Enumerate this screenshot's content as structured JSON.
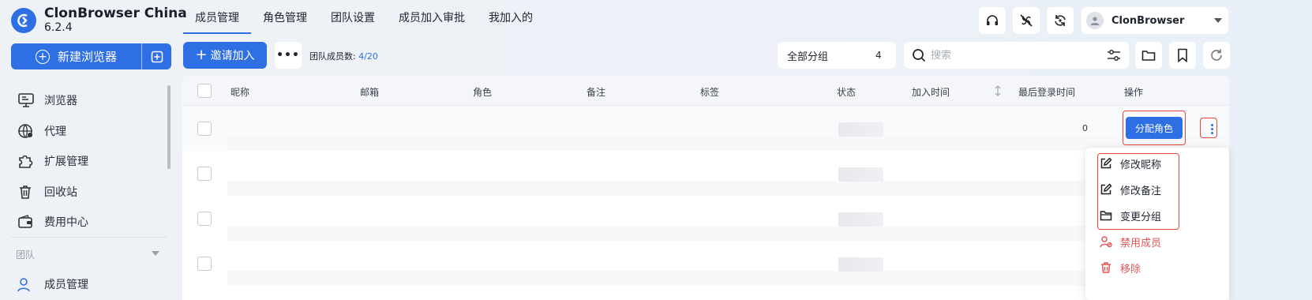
{
  "app": {
    "name": "ClonBrowser China",
    "version": "6.2.4"
  },
  "sidebar": {
    "new_browser_label": "新建浏览器",
    "items": [
      {
        "label": "浏览器",
        "icon": "monitor-icon"
      },
      {
        "label": "代理",
        "icon": "globe-icon"
      },
      {
        "label": "扩展管理",
        "icon": "puzzle-icon"
      },
      {
        "label": "回收站",
        "icon": "trash-icon"
      },
      {
        "label": "费用中心",
        "icon": "wallet-icon"
      }
    ],
    "section_label": "团队",
    "cut_item_label": "成员管理"
  },
  "tabs": [
    {
      "label": "成员管理",
      "active": true
    },
    {
      "label": "角色管理",
      "active": false
    },
    {
      "label": "团队设置",
      "active": false
    },
    {
      "label": "成员加入审批",
      "active": false
    },
    {
      "label": "我加入的",
      "active": false
    }
  ],
  "header": {
    "username": "ClonBrowser"
  },
  "toolbar": {
    "invite_label": "邀请加入",
    "member_count_label": "团队成员数:",
    "member_count_value": "4/20",
    "group_select_label": "全部分组",
    "group_select_count": "4",
    "search_placeholder": "搜索"
  },
  "table": {
    "columns": [
      "昵称",
      "邮箱",
      "角色",
      "备注",
      "标签",
      "状态",
      "加入时间",
      "最后登录时间",
      "操作"
    ],
    "row_count": 4,
    "assign_role_label": "分配角色",
    "partial_text": "0"
  },
  "row_menu": {
    "items": [
      {
        "label": "修改昵称",
        "icon": "edit-icon",
        "danger": false
      },
      {
        "label": "修改备注",
        "icon": "edit-icon",
        "danger": false
      },
      {
        "label": "变更分组",
        "icon": "folder-icon",
        "danger": false
      },
      {
        "label": "禁用成员",
        "icon": "user-ban-icon",
        "danger": true
      },
      {
        "label": "移除",
        "icon": "trash-icon",
        "danger": true
      }
    ]
  },
  "colors": {
    "accent": "#2f6fe4",
    "danger": "#e05757",
    "highlight_frame": "#e14a3a"
  }
}
